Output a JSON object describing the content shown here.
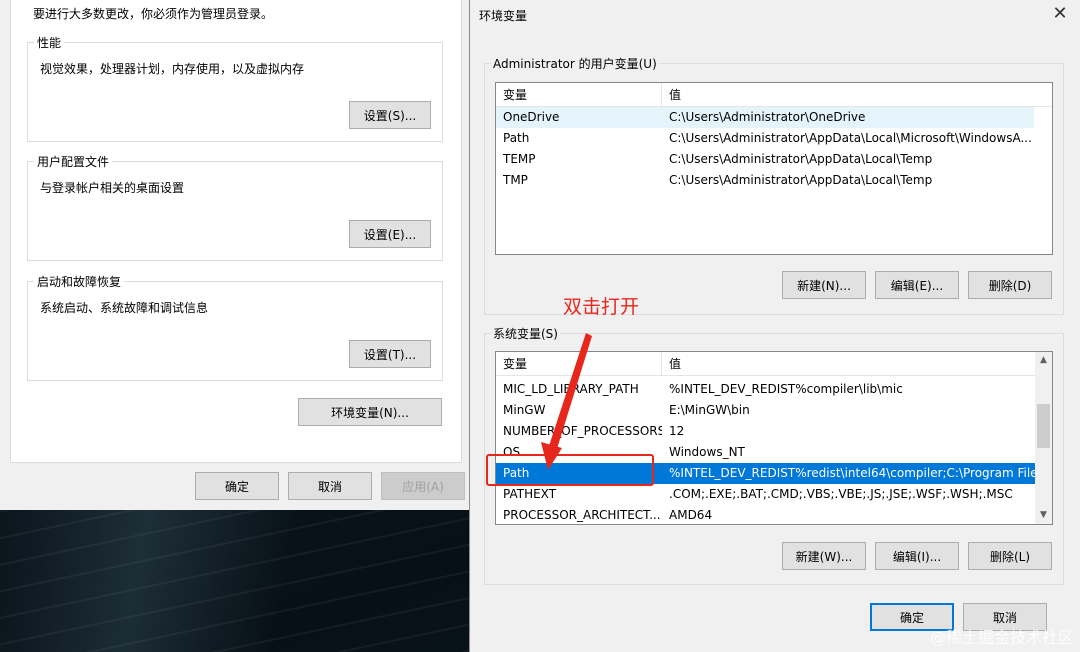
{
  "sys": {
    "top_note": "要进行大多数更改，你必须作为管理员登录。",
    "performance": {
      "title": "性能",
      "desc": "视觉效果，处理器计划，内存使用，以及虚拟内存",
      "button": "设置(S)..."
    },
    "user_profiles": {
      "title": "用户配置文件",
      "desc": "与登录帐户相关的桌面设置",
      "button": "设置(E)..."
    },
    "startup": {
      "title": "启动和故障恢复",
      "desc": "系统启动、系统故障和调试信息",
      "button": "设置(T)..."
    },
    "env_button": "环境变量(N)...",
    "ok": "确定",
    "cancel": "取消",
    "apply": "应用(A)"
  },
  "env": {
    "title": "环境变量",
    "close": "✕",
    "user_section": "Administrator 的用户变量(U)",
    "system_section": "系统变量(S)",
    "col_variable": "变量",
    "col_value": "值",
    "user_vars": [
      {
        "name": "OneDrive",
        "value": "C:\\Users\\Administrator\\OneDrive"
      },
      {
        "name": "Path",
        "value": "C:\\Users\\Administrator\\AppData\\Local\\Microsoft\\WindowsA..."
      },
      {
        "name": "TEMP",
        "value": "C:\\Users\\Administrator\\AppData\\Local\\Temp"
      },
      {
        "name": "TMP",
        "value": "C:\\Users\\Administrator\\AppData\\Local\\Temp"
      }
    ],
    "system_vars": [
      {
        "name": "MIC_LD_LIBRARY_PATH",
        "value": "%INTEL_DEV_REDIST%compiler\\lib\\mic"
      },
      {
        "name": "MinGW",
        "value": "E:\\MinGW\\bin"
      },
      {
        "name": "NUMBER_OF_PROCESSORS",
        "value": "12"
      },
      {
        "name": "OS",
        "value": "Windows_NT"
      },
      {
        "name": "Path",
        "value": "%INTEL_DEV_REDIST%redist\\intel64\\compiler;C:\\Program File..."
      },
      {
        "name": "PATHEXT",
        "value": ".COM;.EXE;.BAT;.CMD;.VBS;.VBE;.JS;.JSE;.WSF;.WSH;.MSC"
      },
      {
        "name": "PROCESSOR_ARCHITECT...",
        "value": "AMD64"
      }
    ],
    "user_buttons": {
      "new": "新建(N)...",
      "edit": "编辑(E)...",
      "delete": "删除(D)"
    },
    "system_buttons": {
      "new": "新建(W)...",
      "edit": "编辑(I)...",
      "delete": "删除(L)"
    },
    "ok": "确定",
    "cancel": "取消"
  },
  "annotation": {
    "text": "双击打开",
    "color": "#e8271c"
  },
  "watermark": "@稀土掘金技术社区",
  "colors": {
    "selection": "#0078d7",
    "annotation": "#e8271c"
  }
}
